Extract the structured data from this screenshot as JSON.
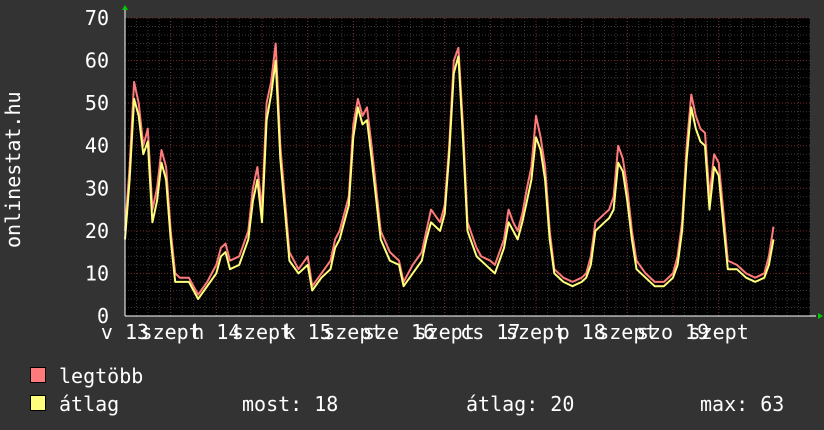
{
  "side_label": "onlinestat.hu",
  "legend": {
    "items": [
      {
        "label": "legtöbb",
        "color": "#ff7b7b"
      },
      {
        "label": "átlag",
        "color": "#ffff7b"
      }
    ],
    "stats": {
      "now_label": "most:",
      "now_value": "18",
      "avg_label": "átlag:",
      "avg_value": "20",
      "max_label": "max:",
      "max_value": "63"
    }
  },
  "chart_data": {
    "type": "line",
    "ylim": [
      0,
      70
    ],
    "yticks": [
      0,
      10,
      20,
      30,
      40,
      50,
      60,
      70
    ],
    "xlim": [
      0,
      7.5
    ],
    "xticks": [
      {
        "x": 0,
        "label": "v 13"
      },
      {
        "x": 0.5,
        "label": "szept"
      },
      {
        "x": 1,
        "label": "h 14"
      },
      {
        "x": 1.5,
        "label": "szept"
      },
      {
        "x": 2,
        "label": "k 15"
      },
      {
        "x": 2.5,
        "label": "szept"
      },
      {
        "x": 3,
        "label": "sze 16"
      },
      {
        "x": 3.5,
        "label": "szept"
      },
      {
        "x": 4,
        "label": "cs 17"
      },
      {
        "x": 4.5,
        "label": "szept"
      },
      {
        "x": 5,
        "label": "p 18"
      },
      {
        "x": 5.5,
        "label": "szept"
      },
      {
        "x": 6,
        "label": "szo 19"
      },
      {
        "x": 6.5,
        "label": "szept"
      }
    ],
    "series": [
      {
        "name": "legtöbb",
        "color": "#ff7b7b",
        "points": [
          [
            0,
            20
          ],
          [
            0.05,
            35
          ],
          [
            0.1,
            55
          ],
          [
            0.15,
            50
          ],
          [
            0.2,
            40
          ],
          [
            0.25,
            44
          ],
          [
            0.3,
            25
          ],
          [
            0.35,
            30
          ],
          [
            0.4,
            39
          ],
          [
            0.45,
            35
          ],
          [
            0.5,
            20
          ],
          [
            0.55,
            10
          ],
          [
            0.6,
            9
          ],
          [
            0.7,
            9
          ],
          [
            0.8,
            5
          ],
          [
            0.9,
            8
          ],
          [
            1.0,
            12
          ],
          [
            1.05,
            16
          ],
          [
            1.1,
            17
          ],
          [
            1.15,
            13
          ],
          [
            1.25,
            14
          ],
          [
            1.35,
            20
          ],
          [
            1.4,
            30
          ],
          [
            1.45,
            35
          ],
          [
            1.5,
            25
          ],
          [
            1.55,
            50
          ],
          [
            1.6,
            55
          ],
          [
            1.65,
            64
          ],
          [
            1.7,
            40
          ],
          [
            1.8,
            15
          ],
          [
            1.9,
            11
          ],
          [
            2.0,
            14
          ],
          [
            2.05,
            7
          ],
          [
            2.15,
            10
          ],
          [
            2.25,
            13
          ],
          [
            2.3,
            18
          ],
          [
            2.35,
            20
          ],
          [
            2.4,
            24
          ],
          [
            2.45,
            28
          ],
          [
            2.5,
            45
          ],
          [
            2.55,
            51
          ],
          [
            2.6,
            47
          ],
          [
            2.65,
            49
          ],
          [
            2.7,
            40
          ],
          [
            2.8,
            20
          ],
          [
            2.9,
            15
          ],
          [
            3.0,
            13
          ],
          [
            3.05,
            8
          ],
          [
            3.15,
            12
          ],
          [
            3.25,
            15
          ],
          [
            3.3,
            20
          ],
          [
            3.35,
            25
          ],
          [
            3.45,
            22
          ],
          [
            3.5,
            26
          ],
          [
            3.55,
            40
          ],
          [
            3.6,
            60
          ],
          [
            3.65,
            63
          ],
          [
            3.7,
            45
          ],
          [
            3.75,
            22
          ],
          [
            3.85,
            16
          ],
          [
            3.9,
            14
          ],
          [
            4.0,
            13
          ],
          [
            4.05,
            12
          ],
          [
            4.15,
            18
          ],
          [
            4.2,
            25
          ],
          [
            4.25,
            22
          ],
          [
            4.3,
            20
          ],
          [
            4.35,
            24
          ],
          [
            4.4,
            30
          ],
          [
            4.45,
            35
          ],
          [
            4.5,
            47
          ],
          [
            4.55,
            42
          ],
          [
            4.6,
            35
          ],
          [
            4.65,
            20
          ],
          [
            4.7,
            11
          ],
          [
            4.8,
            9
          ],
          [
            4.9,
            8
          ],
          [
            5.0,
            9
          ],
          [
            5.05,
            10
          ],
          [
            5.1,
            14
          ],
          [
            5.15,
            22
          ],
          [
            5.25,
            24
          ],
          [
            5.3,
            25
          ],
          [
            5.35,
            28
          ],
          [
            5.4,
            40
          ],
          [
            5.45,
            37
          ],
          [
            5.5,
            30
          ],
          [
            5.55,
            20
          ],
          [
            5.6,
            13
          ],
          [
            5.7,
            10
          ],
          [
            5.8,
            8
          ],
          [
            5.9,
            8
          ],
          [
            6.0,
            10
          ],
          [
            6.05,
            14
          ],
          [
            6.1,
            22
          ],
          [
            6.15,
            40
          ],
          [
            6.2,
            52
          ],
          [
            6.25,
            47
          ],
          [
            6.3,
            44
          ],
          [
            6.35,
            43
          ],
          [
            6.4,
            28
          ],
          [
            6.45,
            38
          ],
          [
            6.5,
            36
          ],
          [
            6.55,
            25
          ],
          [
            6.6,
            13
          ],
          [
            6.7,
            12
          ],
          [
            6.8,
            10
          ],
          [
            6.9,
            9
          ],
          [
            7.0,
            10
          ],
          [
            7.05,
            14
          ],
          [
            7.1,
            21
          ]
        ]
      },
      {
        "name": "átlag",
        "color": "#ffff7b",
        "points": [
          [
            0,
            18
          ],
          [
            0.05,
            32
          ],
          [
            0.1,
            51
          ],
          [
            0.15,
            47
          ],
          [
            0.2,
            38
          ],
          [
            0.25,
            41
          ],
          [
            0.3,
            22
          ],
          [
            0.35,
            27
          ],
          [
            0.4,
            36
          ],
          [
            0.45,
            32
          ],
          [
            0.5,
            18
          ],
          [
            0.55,
            8
          ],
          [
            0.6,
            8
          ],
          [
            0.7,
            8
          ],
          [
            0.8,
            4
          ],
          [
            0.9,
            7
          ],
          [
            1.0,
            10
          ],
          [
            1.05,
            14
          ],
          [
            1.1,
            15
          ],
          [
            1.15,
            11
          ],
          [
            1.25,
            12
          ],
          [
            1.35,
            18
          ],
          [
            1.4,
            27
          ],
          [
            1.45,
            32
          ],
          [
            1.5,
            22
          ],
          [
            1.55,
            46
          ],
          [
            1.6,
            52
          ],
          [
            1.65,
            60
          ],
          [
            1.7,
            37
          ],
          [
            1.8,
            13
          ],
          [
            1.9,
            10
          ],
          [
            2.0,
            12
          ],
          [
            2.05,
            6
          ],
          [
            2.15,
            9
          ],
          [
            2.25,
            11
          ],
          [
            2.3,
            16
          ],
          [
            2.35,
            18
          ],
          [
            2.4,
            22
          ],
          [
            2.45,
            26
          ],
          [
            2.5,
            42
          ],
          [
            2.55,
            49
          ],
          [
            2.6,
            45
          ],
          [
            2.65,
            46
          ],
          [
            2.7,
            37
          ],
          [
            2.8,
            18
          ],
          [
            2.9,
            13
          ],
          [
            3.0,
            12
          ],
          [
            3.05,
            7
          ],
          [
            3.15,
            10
          ],
          [
            3.25,
            13
          ],
          [
            3.3,
            18
          ],
          [
            3.35,
            22
          ],
          [
            3.45,
            20
          ],
          [
            3.5,
            24
          ],
          [
            3.55,
            38
          ],
          [
            3.6,
            57
          ],
          [
            3.65,
            61
          ],
          [
            3.7,
            42
          ],
          [
            3.75,
            20
          ],
          [
            3.85,
            14
          ],
          [
            3.9,
            13
          ],
          [
            4.0,
            11
          ],
          [
            4.05,
            10
          ],
          [
            4.15,
            16
          ],
          [
            4.2,
            22
          ],
          [
            4.25,
            20
          ],
          [
            4.3,
            18
          ],
          [
            4.35,
            22
          ],
          [
            4.4,
            27
          ],
          [
            4.45,
            32
          ],
          [
            4.5,
            42
          ],
          [
            4.55,
            39
          ],
          [
            4.6,
            32
          ],
          [
            4.65,
            18
          ],
          [
            4.7,
            10
          ],
          [
            4.8,
            8
          ],
          [
            4.9,
            7
          ],
          [
            5.0,
            8
          ],
          [
            5.05,
            9
          ],
          [
            5.1,
            12
          ],
          [
            5.15,
            20
          ],
          [
            5.25,
            22
          ],
          [
            5.3,
            23
          ],
          [
            5.35,
            25
          ],
          [
            5.4,
            36
          ],
          [
            5.45,
            34
          ],
          [
            5.5,
            27
          ],
          [
            5.55,
            18
          ],
          [
            5.6,
            11
          ],
          [
            5.7,
            9
          ],
          [
            5.8,
            7
          ],
          [
            5.9,
            7
          ],
          [
            6.0,
            9
          ],
          [
            6.05,
            12
          ],
          [
            6.1,
            20
          ],
          [
            6.15,
            37
          ],
          [
            6.2,
            49
          ],
          [
            6.25,
            44
          ],
          [
            6.3,
            41
          ],
          [
            6.35,
            40
          ],
          [
            6.4,
            25
          ],
          [
            6.45,
            35
          ],
          [
            6.5,
            33
          ],
          [
            6.55,
            22
          ],
          [
            6.6,
            11
          ],
          [
            6.7,
            11
          ],
          [
            6.8,
            9
          ],
          [
            6.9,
            8
          ],
          [
            7.0,
            9
          ],
          [
            7.05,
            12
          ],
          [
            7.1,
            18
          ]
        ]
      }
    ]
  }
}
